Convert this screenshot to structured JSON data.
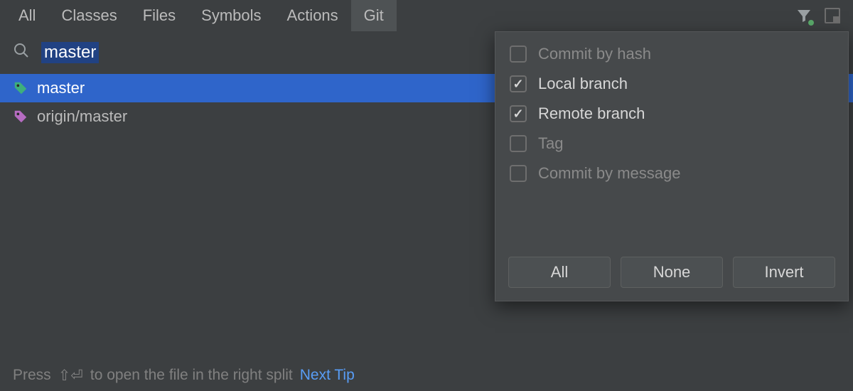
{
  "tabs": [
    {
      "label": "All"
    },
    {
      "label": "Classes"
    },
    {
      "label": "Files"
    },
    {
      "label": "Symbols"
    },
    {
      "label": "Actions"
    },
    {
      "label": "Git",
      "selected": true
    }
  ],
  "search": {
    "value": "master"
  },
  "results": [
    {
      "label": "master",
      "icon_color": "#3eaf7c",
      "selected": true
    },
    {
      "label": "origin/master",
      "icon_color": "#b66cc2",
      "selected": false
    }
  ],
  "filter": {
    "options": [
      {
        "label": "Commit by hash",
        "checked": false,
        "enabled": false
      },
      {
        "label": "Local branch",
        "checked": true,
        "enabled": true
      },
      {
        "label": "Remote branch",
        "checked": true,
        "enabled": true
      },
      {
        "label": "Tag",
        "checked": false,
        "enabled": false
      },
      {
        "label": "Commit by message",
        "checked": false,
        "enabled": false
      }
    ],
    "buttons": {
      "all": "All",
      "none": "None",
      "invert": "Invert"
    }
  },
  "statusbar": {
    "prefix": "Press",
    "shortcut": "⇧⏎",
    "suffix": "to open the file in the right split",
    "link": "Next Tip"
  }
}
